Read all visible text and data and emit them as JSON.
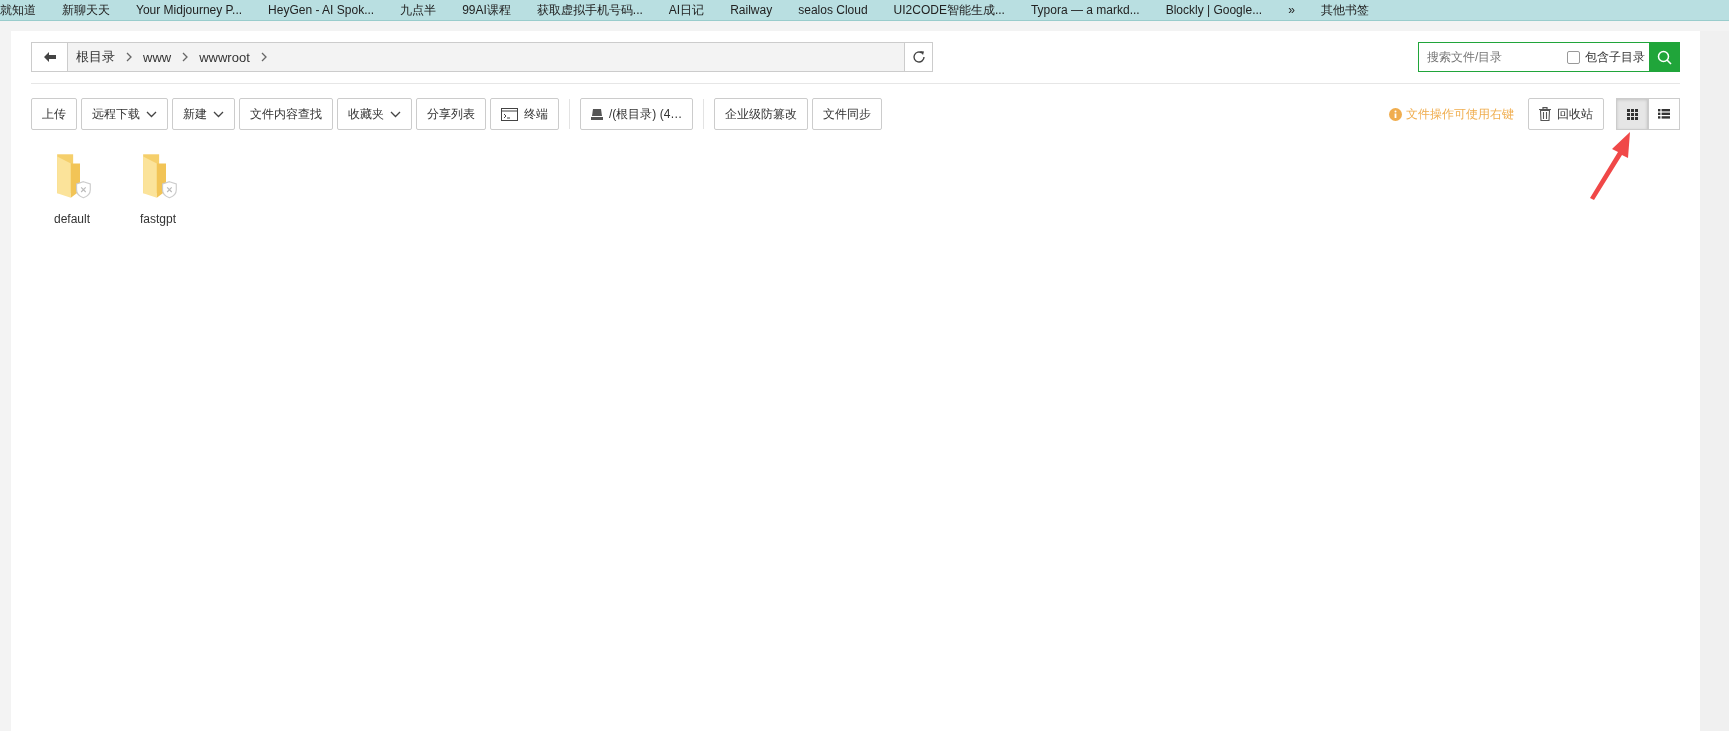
{
  "bookmarks": [
    "就知道",
    "新聊天天",
    "Your Midjourney P...",
    "HeyGen - AI Spok...",
    "九点半",
    "99AI课程",
    "获取虚拟手机号码...",
    "AI日记",
    "Railway",
    "sealos Cloud",
    "UI2CODE智能生成...",
    "Typora — a markd...",
    "Blockly | Google..."
  ],
  "bookmarks_more": "»",
  "other_bookmarks": "其他书签",
  "breadcrumb": [
    "根目录",
    "www",
    "wwwroot"
  ],
  "search": {
    "placeholder": "搜索文件/目录",
    "subdirs_label": "包含子目录",
    "subdirs_checked": false
  },
  "toolbar": [
    {
      "label": "上传",
      "kind": "plain"
    },
    {
      "label": "远程下载",
      "kind": "dropdown"
    },
    {
      "label": "新建",
      "kind": "dropdown"
    },
    {
      "label": "文件内容查找",
      "kind": "plain"
    },
    {
      "label": "收藏夹",
      "kind": "dropdown"
    },
    {
      "label": "分享列表",
      "kind": "plain"
    },
    {
      "label": "终端",
      "kind": "terminal"
    },
    {
      "label": "/(根目录) (4…",
      "kind": "disk",
      "divider_before": true
    },
    {
      "label": "企业级防篡改",
      "kind": "plain",
      "divider_before": true
    },
    {
      "label": "文件同步",
      "kind": "plain"
    }
  ],
  "hint": "文件操作可使用右键",
  "recycle_bin": "回收站",
  "view_modes": [
    {
      "kind": "grid",
      "selected": true
    },
    {
      "kind": "list",
      "selected": false
    }
  ],
  "files": [
    {
      "name": "default"
    },
    {
      "name": "fastgpt"
    }
  ]
}
